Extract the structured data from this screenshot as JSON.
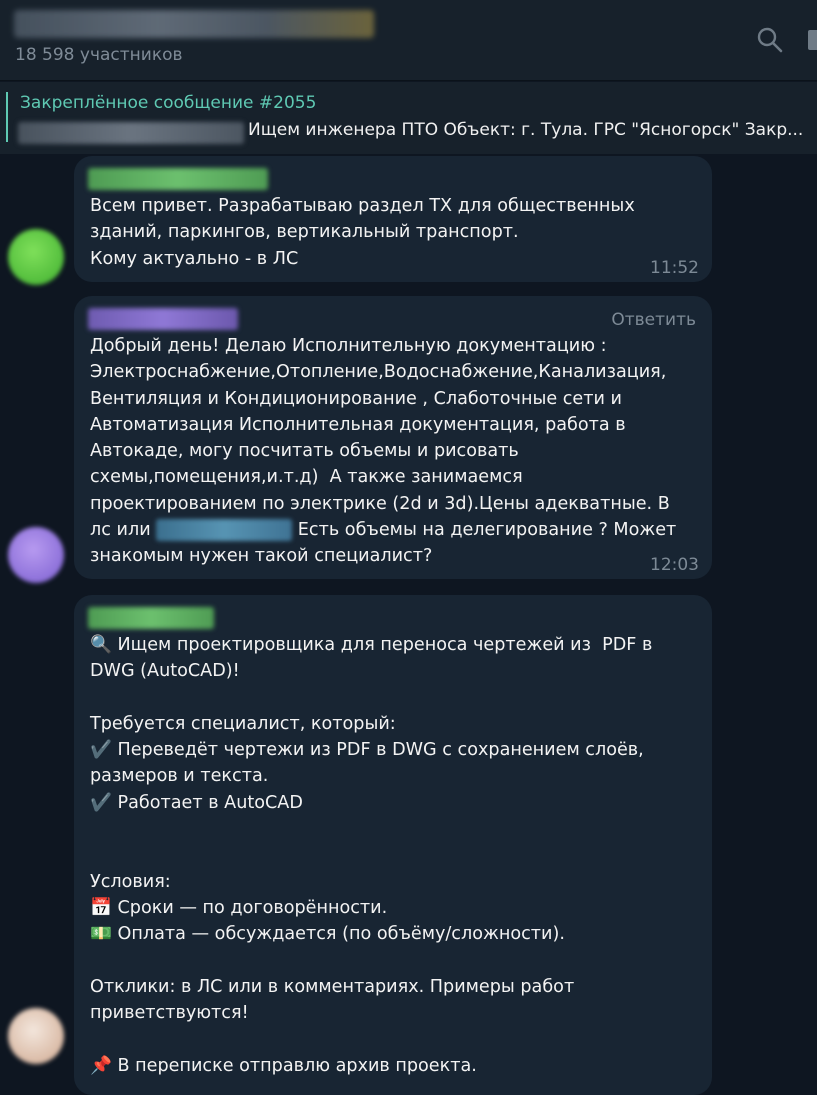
{
  "header": {
    "members": "18 598 участников"
  },
  "pinned": {
    "title": "Закреплённое сообщение #2055",
    "text": "Ищем инженера ПТО  Объект: г. Тула. ГРС \"Ясногорск\" Закр..."
  },
  "messages": [
    {
      "text": "Всем привет. Разрабатываю раздел ТХ для общественных\nзданий, паркингов, вертикальный транспорт.\nКому актуально - в ЛС",
      "time": "11:52"
    },
    {
      "reply_label": "Ответить",
      "text_before": "Добрый день! Делаю Исполнительную документацию :\nЭлектроснабжение,Отопление,Водоснабжение,Канализация,\nВентиляция и Кондиционирование , Слаботочные сети и\nАвтоматизация Исполнительная документация, работа в\nАвтокаде, могу посчитать объемы и рисовать\nсхемы,помещения,и.т.д)  А также занимаемся\nпроектированием по электрике (2d и 3d).Цены адекватные. В\nлс или ",
      "text_after": " Есть объемы на делегирование ? Может\nзнакомым нужен такой специалист?",
      "time": "12:03"
    },
    {
      "text": "🔍 Ищем проектировщика для переноса чертежей из  PDF в\nDWG (AutoCAD)!\n\nТребуется специалист, который:\n✔️ Переведёт чертежи из PDF в DWG с сохранением слоёв,\nразмеров и текста.\n✔️ Работает в AutoCAD\n\n\nУсловия:\n📅 Сроки — по договорённости.\n💵 Оплата — обсуждается (по объёму/сложности).\n\nОтклики: в ЛС или в комментариях. Примеры работ\nприветствуются!\n\n📌 В переписке отправлю архив проекта."
    }
  ],
  "colors": {
    "background": "#0e1621",
    "panel": "#17212b",
    "bubble": "#182533",
    "accent": "#5fc9b3",
    "muted": "#7d8a96"
  }
}
